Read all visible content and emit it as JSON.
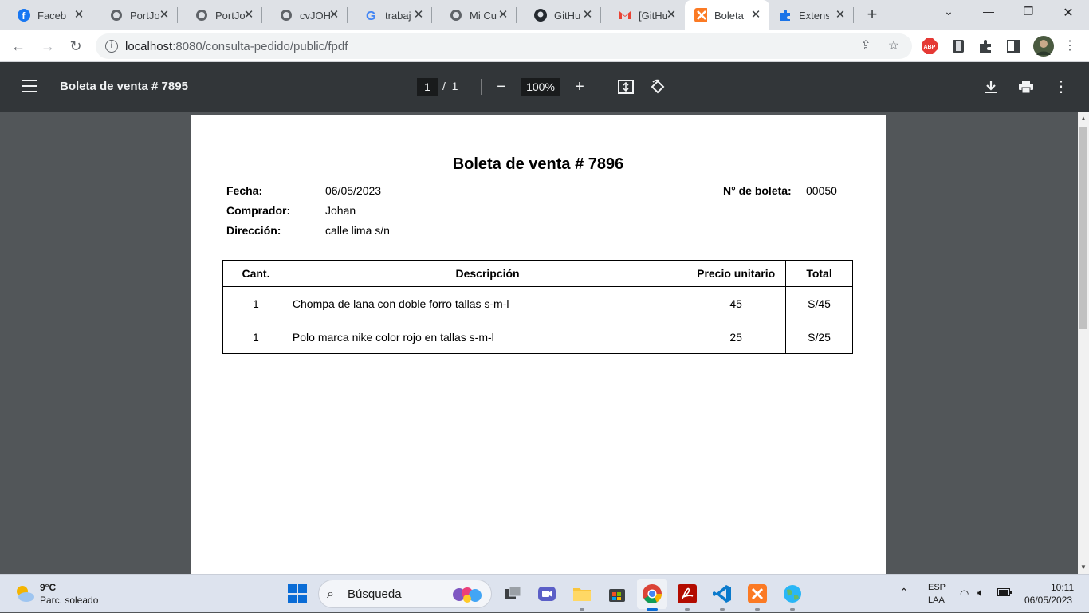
{
  "browser": {
    "tabs": [
      {
        "label": "Faceb",
        "icon": "facebook-icon",
        "active": false
      },
      {
        "label": "PortJo",
        "icon": "globe-icon",
        "active": false
      },
      {
        "label": "PortJo",
        "icon": "globe-icon",
        "active": false
      },
      {
        "label": "cvJOH",
        "icon": "globe-icon",
        "active": false
      },
      {
        "label": "trabaj",
        "icon": "google-icon",
        "active": false
      },
      {
        "label": "Mi Cu",
        "icon": "globe-icon",
        "active": false
      },
      {
        "label": "GitHu",
        "icon": "github-icon",
        "active": false
      },
      {
        "label": "[GitHu",
        "icon": "gmail-icon",
        "active": false
      },
      {
        "label": "Boleta",
        "icon": "xampp-icon",
        "active": true
      },
      {
        "label": "Extens",
        "icon": "puzzle-icon",
        "active": false
      }
    ],
    "url_host": "localhost",
    "url_rest": ":8080/consulta-pedido/public/fpdf"
  },
  "pdf_viewer": {
    "title": "Boleta de venta # 7895",
    "current_page": "1",
    "page_separator": "/",
    "total_pages": "1",
    "zoom": "100%"
  },
  "document": {
    "title": "Boleta de venta # 7896",
    "fields": [
      {
        "label": "Fecha:",
        "value": "06/05/2023"
      },
      {
        "label": "Comprador:",
        "value": "Johan"
      },
      {
        "label": "Dirección:",
        "value": "calle lima s/n"
      }
    ],
    "boleta_label": "N° de boleta:",
    "boleta_value": "00050",
    "table": {
      "headers": [
        "Cant.",
        "Descripción",
        "Precio unitario",
        "Total"
      ],
      "rows": [
        [
          "1",
          "Chompa de lana con doble forro tallas s-m-l",
          "45",
          "S/45"
        ],
        [
          "1",
          "Polo marca nike color rojo en tallas s-m-l",
          "25",
          "S/25"
        ]
      ]
    }
  },
  "taskbar": {
    "temperature": "9°C",
    "condition": "Parc. soleado",
    "search_label": "Búsqueda",
    "lang_top": "ESP",
    "lang_bottom": "LAA",
    "time": "10:11",
    "date": "06/05/2023"
  }
}
